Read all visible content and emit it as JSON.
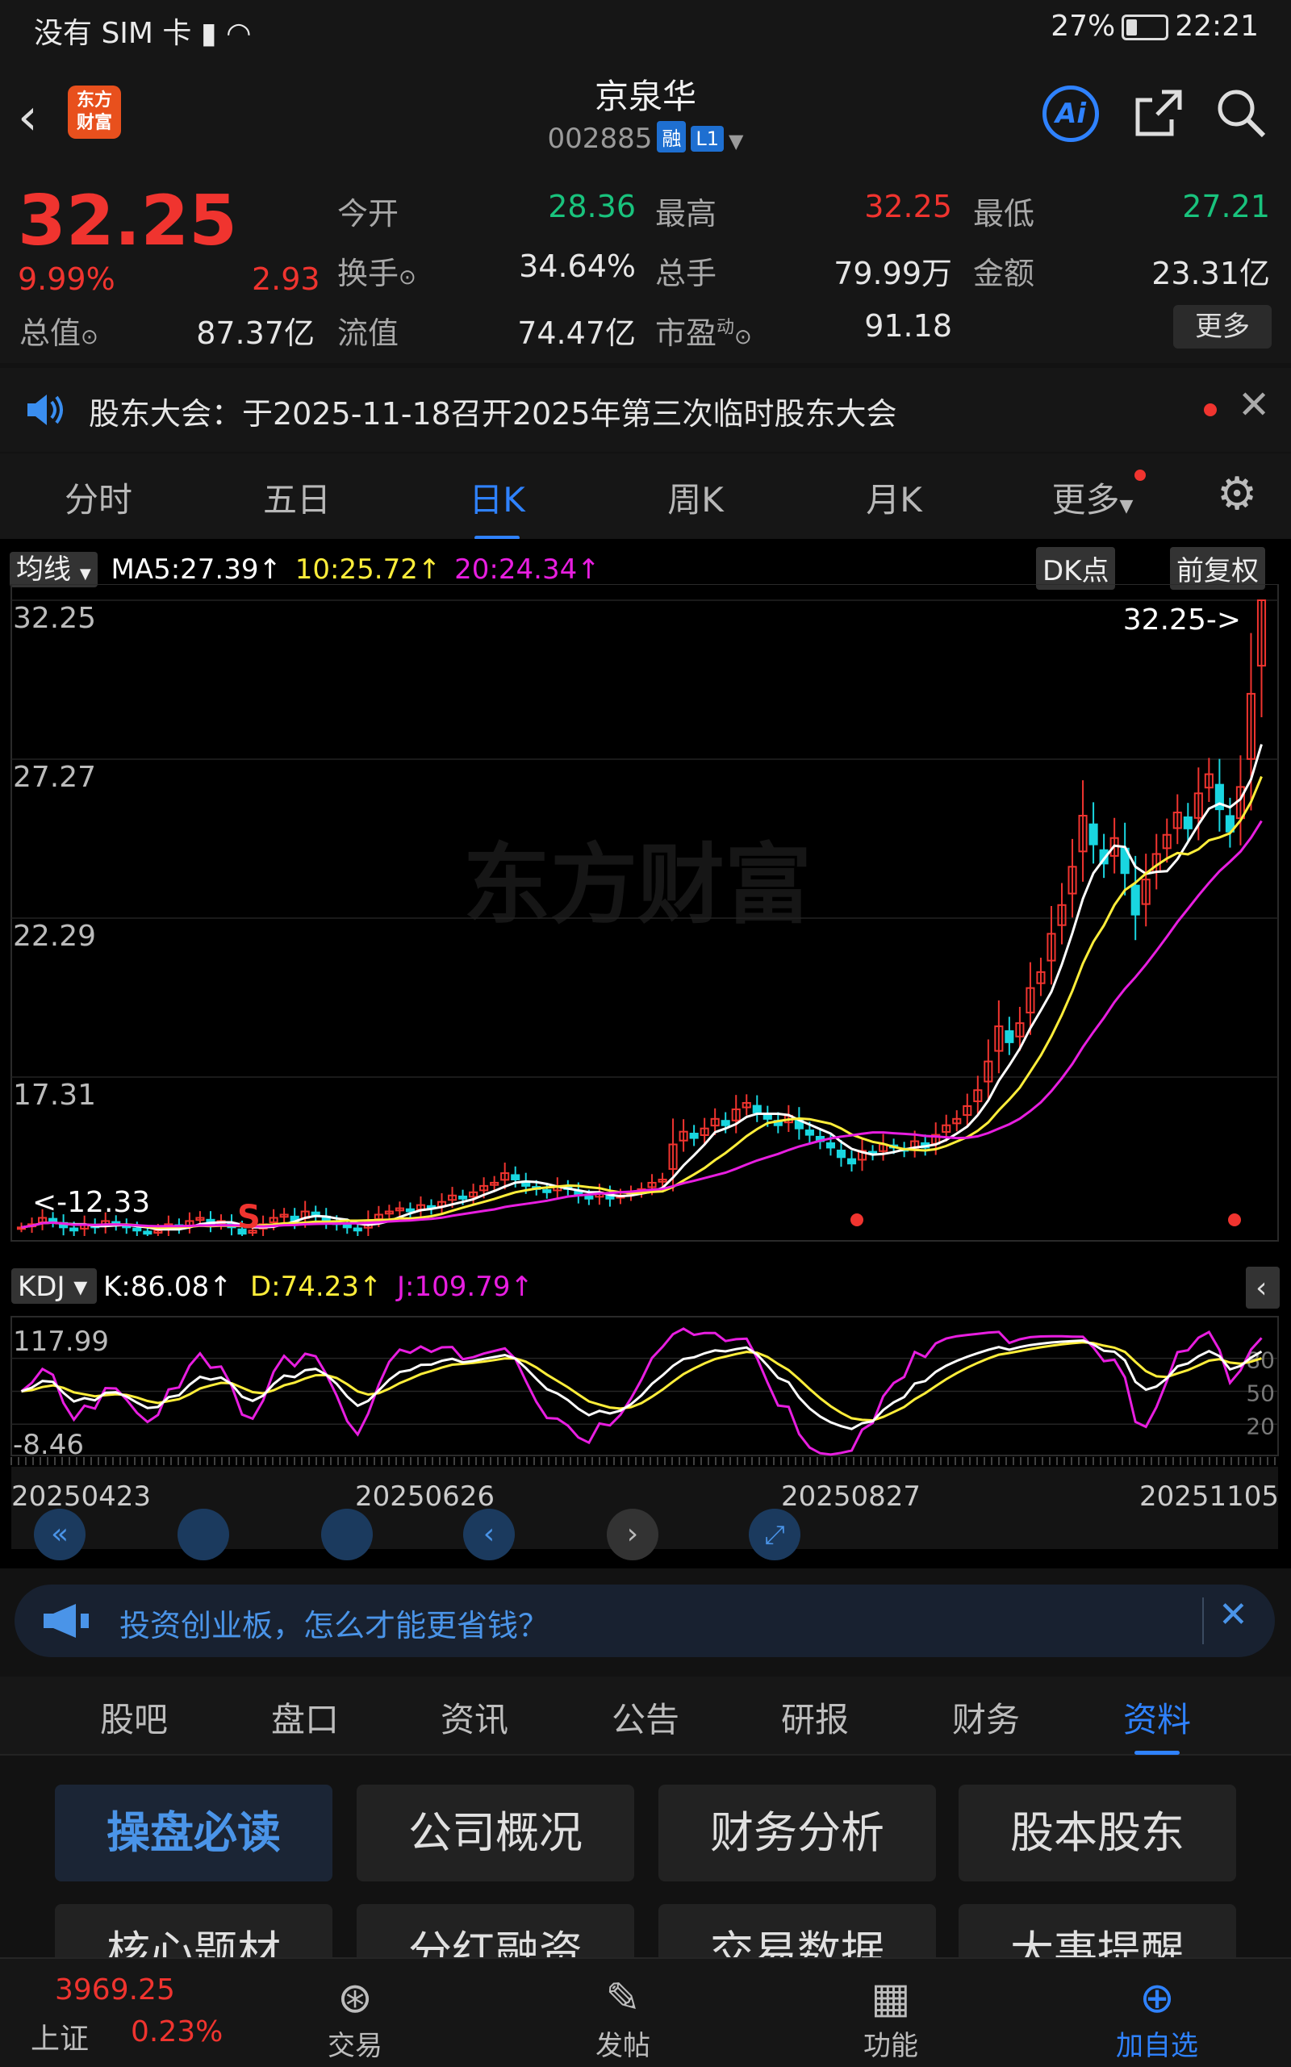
{
  "status_bar": {
    "carrier": "没有 SIM 卡",
    "battery": "27%",
    "time": "22:21"
  },
  "header": {
    "stock_name": "京泉华",
    "stock_code": "002885",
    "tag_rong": "融",
    "tag_level": "L1",
    "logo_text_1": "东方",
    "logo_text_2": "财富",
    "ai_label": "Ai"
  },
  "quote": {
    "price": "32.25",
    "change_pct": "9.99%",
    "change": "2.93",
    "open_label": "今开",
    "open": "28.36",
    "high_label": "最高",
    "high": "32.25",
    "low_label": "最低",
    "low": "27.21",
    "turnover_label": "换手",
    "turnover": "34.64%",
    "volume_label": "总手",
    "volume": "79.99万",
    "amount_label": "金额",
    "amount": "23.31亿",
    "total_cap_label": "总值",
    "total_cap": "87.37亿",
    "float_cap_label": "流值",
    "float_cap": "74.47亿",
    "pe_label": "市盈",
    "pe_sup": "动",
    "pe": "91.18",
    "more": "更多"
  },
  "notice": {
    "text": "股东大会：于2025-11-18召开2025年第三次临时股东大会"
  },
  "period_tabs": [
    "分时",
    "五日",
    "日K",
    "周K",
    "月K",
    "更多"
  ],
  "chart_header": {
    "ma_select": "均线",
    "ma5": "MA5:27.39↑",
    "ma10": "10:25.72↑",
    "ma20": "20:24.34↑",
    "dk": "DK点",
    "adjust": "前复权"
  },
  "kdj_header": {
    "select": "KDJ",
    "k": "K:86.08↑",
    "d": "D:74.23↑",
    "j": "J:109.79↑"
  },
  "chart_data": [
    {
      "type": "candlestick",
      "y_ticks": [
        "32.25",
        "27.27",
        "22.29",
        "17.31"
      ],
      "ylim": [
        12.33,
        32.25
      ],
      "last_price_label": "32.25->",
      "low_price_label": "<-12.33",
      "sell_marker": "S",
      "x_tick_labels": [
        "20250423",
        "20250626",
        "20250827",
        "20251105"
      ],
      "candles_close": [
        12.6,
        12.7,
        12.9,
        12.8,
        12.6,
        12.5,
        12.7,
        12.6,
        12.8,
        12.7,
        12.6,
        12.5,
        12.4,
        12.5,
        12.7,
        12.6,
        12.8,
        12.9,
        12.7,
        12.8,
        12.6,
        12.4,
        12.5,
        12.7,
        12.9,
        13.0,
        12.8,
        13.1,
        13.0,
        12.8,
        12.7,
        12.6,
        12.5,
        12.8,
        13.0,
        13.1,
        13.2,
        13.1,
        13.3,
        13.2,
        13.4,
        13.6,
        13.5,
        13.7,
        13.9,
        14.0,
        14.3,
        14.1,
        13.9,
        13.8,
        13.7,
        13.9,
        13.8,
        13.6,
        13.5,
        13.7,
        13.5,
        13.6,
        13.7,
        13.8,
        14.0,
        14.1,
        15.2,
        15.6,
        15.4,
        15.7,
        16.0,
        15.8,
        16.3,
        16.5,
        16.2,
        16.0,
        15.8,
        16.1,
        15.7,
        15.5,
        15.3,
        15.1,
        14.8,
        14.6,
        15.0,
        14.9,
        15.2,
        15.1,
        15.0,
        15.3,
        15.1,
        15.5,
        15.8,
        16.0,
        16.4,
        16.9,
        17.8,
        18.9,
        18.4,
        19.0,
        20.1,
        20.6,
        21.8,
        22.7,
        23.9,
        25.5,
        24.6,
        24.0,
        24.8,
        23.7,
        22.4,
        23.5,
        24.3,
        24.9,
        25.6,
        25.1,
        26.2,
        26.8,
        25.7,
        25.0,
        26.4,
        29.32,
        32.25
      ],
      "ma5_last": 27.39,
      "ma10_last": 25.72,
      "ma20_last": 24.34
    },
    {
      "type": "line",
      "title": "KDJ",
      "y_ticks": [
        "117.99",
        "-8.46"
      ],
      "right_ticks": [
        "80",
        "50",
        "20"
      ],
      "ylim": [
        -8.46,
        117.99
      ],
      "series": [
        {
          "name": "K",
          "last": 86.08
        },
        {
          "name": "D",
          "last": 74.23
        },
        {
          "name": "J",
          "last": 109.79
        }
      ]
    }
  ],
  "promo": {
    "text": "投资创业板，怎么才能更省钱？"
  },
  "section_tabs": [
    "股吧",
    "盘口",
    "资讯",
    "公告",
    "研报",
    "财务",
    "资料"
  ],
  "grid_buttons": [
    "操盘必读",
    "公司概况",
    "财务分析",
    "股本股东",
    "核心题材",
    "分红融资",
    "交易数据",
    "大事提醒"
  ],
  "bottom_nav": {
    "index_value": "3969.25",
    "index_name": "上证",
    "index_pct": "0.23%",
    "items": [
      "交易",
      "发帖",
      "功能",
      "加自选"
    ]
  },
  "colors": {
    "up": "#f0342f",
    "down": "#19c37d",
    "accent": "#2f82ff",
    "ma5": "#ffffff",
    "ma10": "#ffee3a",
    "ma20": "#e81ee0"
  },
  "watermark": "东方财富"
}
